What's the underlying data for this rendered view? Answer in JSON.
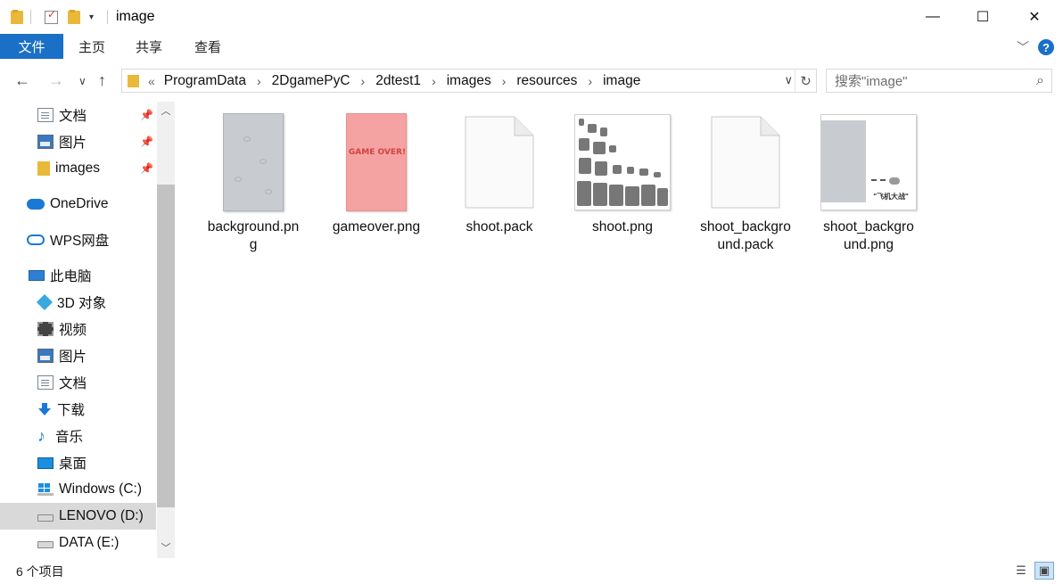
{
  "window": {
    "title": "image",
    "minimize": "—",
    "maximize": "☐",
    "close": "✕"
  },
  "ribbon": {
    "tabs": [
      "文件",
      "主页",
      "共享",
      "查看"
    ],
    "help": "?"
  },
  "address": {
    "prefix": "«",
    "crumbs": [
      "ProgramData",
      "2DgamePyC",
      "2dtest1",
      "images",
      "resources",
      "image"
    ],
    "separator": "›"
  },
  "search": {
    "placeholder": "搜索\"image\""
  },
  "sidebar": {
    "items": [
      {
        "label": "文档",
        "icon": "document-icon",
        "pinned": true
      },
      {
        "label": "图片",
        "icon": "pictures-icon",
        "pinned": true
      },
      {
        "label": "images",
        "icon": "folder-icon",
        "pinned": true
      },
      {
        "label": "OneDrive",
        "icon": "onedrive-icon"
      },
      {
        "label": "WPS网盘",
        "icon": "wps-cloud-icon"
      },
      {
        "label": "此电脑",
        "icon": "this-pc-icon"
      },
      {
        "label": "3D 对象",
        "icon": "3d-objects-icon"
      },
      {
        "label": "视频",
        "icon": "videos-icon"
      },
      {
        "label": "图片",
        "icon": "pictures-icon"
      },
      {
        "label": "文档",
        "icon": "document-icon"
      },
      {
        "label": "下载",
        "icon": "download-icon"
      },
      {
        "label": "音乐",
        "icon": "music-icon"
      },
      {
        "label": "桌面",
        "icon": "desktop-icon"
      },
      {
        "label": "Windows (C:)",
        "icon": "drive-icon"
      },
      {
        "label": "LENOVO (D:)",
        "icon": "drive-icon",
        "selected": true
      },
      {
        "label": "DATA (E:)",
        "icon": "drive-icon"
      }
    ]
  },
  "files": [
    {
      "name": "background.png",
      "line1": "background.pn",
      "line2": "g",
      "kind": "background"
    },
    {
      "name": "gameover.png",
      "line1": "gameover.png",
      "line2": "",
      "kind": "gameover",
      "thumb_text": "GAME OVER!"
    },
    {
      "name": "shoot.pack",
      "line1": "shoot.pack",
      "line2": "",
      "kind": "blank"
    },
    {
      "name": "shoot.png",
      "line1": "shoot.png",
      "line2": "",
      "kind": "sprites"
    },
    {
      "name": "shoot_background.pack",
      "line1": "shoot_backgro",
      "line2": "und.pack",
      "kind": "blank"
    },
    {
      "name": "shoot_background.png",
      "line1": "shoot_backgro",
      "line2": "und.png",
      "kind": "sb",
      "thumb_text": "\"飞机大战\""
    }
  ],
  "status": {
    "count": "6 个项目"
  },
  "colors": {
    "accent": "#1a6fc7",
    "selected_nav": "#d9d9d9"
  }
}
